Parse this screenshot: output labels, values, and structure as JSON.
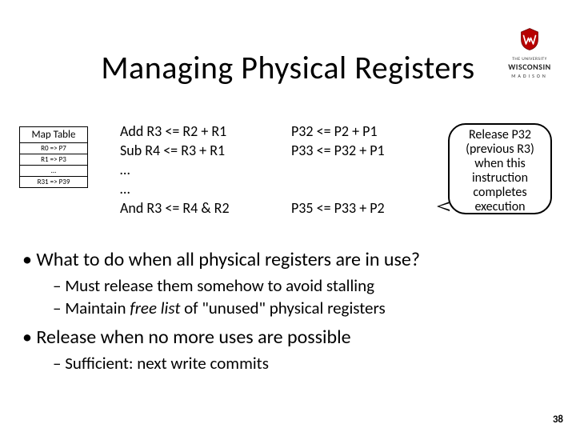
{
  "title": "Managing Physical Registers",
  "logo": {
    "the": "THE UNIVERSITY",
    "wis": "WISCONSIN",
    "mad": "MADISON"
  },
  "maptable": {
    "header": "Map Table",
    "rows": [
      "R0 => P7",
      "R1 => P3",
      "…",
      "R31 => P39"
    ]
  },
  "arch_col": [
    "Add R3 <= R2 + R1",
    "Sub R4 <= R3 + R1",
    "…",
    "…",
    "And R3 <= R4 & R2"
  ],
  "phys_col": [
    "P32 <= P2 + P1",
    "P33 <= P32 + P1",
    "",
    "",
    "P35 <= P33 + P2"
  ],
  "callout": {
    "l1": "Release P32",
    "l2": "(previous R3)",
    "l3": "when this",
    "l4": "instruction",
    "l5": "completes",
    "l6": "execution"
  },
  "bullets": {
    "b1a": "What to do when all physical registers are in use?",
    "b2a": "Must release them somehow to avoid stalling",
    "b2b_pre": "Maintain ",
    "b2b_em": "free list",
    "b2b_post": " of \"unused\" physical registers",
    "b1b": "Release when no more uses are possible",
    "b2c": "Sufficient: next write commits"
  },
  "pagenum": "38"
}
